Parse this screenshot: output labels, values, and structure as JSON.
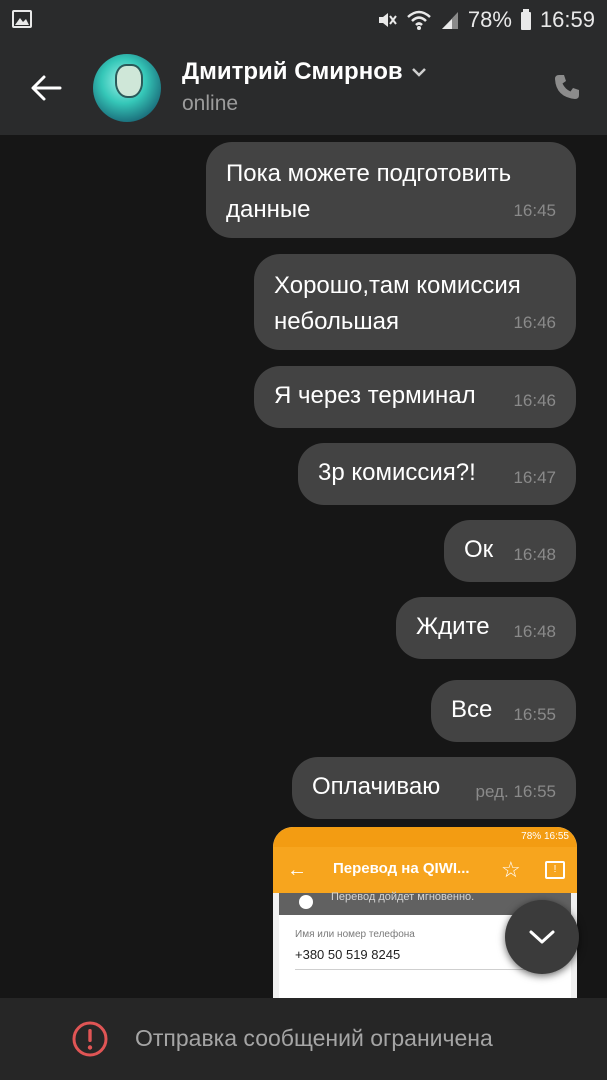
{
  "status_bar": {
    "battery": "78%",
    "time": "16:59"
  },
  "header": {
    "contact_name": "Дмитрий Смирнов",
    "status": "online"
  },
  "messages": [
    {
      "text": "Пока можете подготовить данные",
      "time": "16:45"
    },
    {
      "text": "Хорошо,там комиссия небольшая",
      "time": "16:46"
    },
    {
      "text": "Я через терминал",
      "time": "16:46"
    },
    {
      "text": "3р комиссия?!",
      "time": "16:47"
    },
    {
      "text": "Ок",
      "time": "16:48"
    },
    {
      "text": "Ждите",
      "time": "16:48"
    },
    {
      "text": "Все",
      "time": "16:55"
    },
    {
      "text": "Оплачиваю",
      "time": "ред. 16:55"
    }
  ],
  "attachment": {
    "status_battery": "78%",
    "status_time": "16:55",
    "title": "Перевод на QIWI...",
    "notice": "Перевод дойдет мгновенно.",
    "field_label": "Имя или номер телефона",
    "field_value": "+380 50 519 8245"
  },
  "footer": {
    "restriction_text": "Отправка сообщений ограничена"
  },
  "colors": {
    "header_bg": "#2a2b2c",
    "bubble_bg": "#434343",
    "background": "#161616",
    "warning": "#e05555",
    "qiwi_orange": "#f7a51e"
  },
  "icons": [
    "gallery-icon",
    "mute-icon",
    "wifi-icon",
    "signal-icon",
    "battery-icon",
    "back-arrow-icon",
    "chevron-down-icon",
    "phone-icon",
    "star-icon",
    "message-icon",
    "warning-icon"
  ]
}
